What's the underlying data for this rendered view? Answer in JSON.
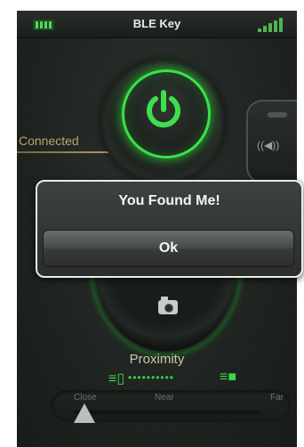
{
  "app": {
    "title": "BLE Key"
  },
  "status": {
    "connected_label": "Connected"
  },
  "proximity": {
    "label": "Proximity",
    "dots": "••••••••••",
    "slider_labels": [
      "Close",
      "Near",
      "Far"
    ],
    "slider_value": 0
  },
  "dialog": {
    "title": "You Found Me!",
    "ok_label": "Ok"
  },
  "icons": {
    "battery": "battery-icon",
    "signal": "signal-icon",
    "power": "power-icon",
    "alarm": "alarm-icon",
    "camera": "camera-icon",
    "phone": "phone-icon",
    "lock": "lock-icon"
  },
  "colors": {
    "accent": "#3de04a",
    "connected": "#b9a36a",
    "background": "#202522"
  }
}
